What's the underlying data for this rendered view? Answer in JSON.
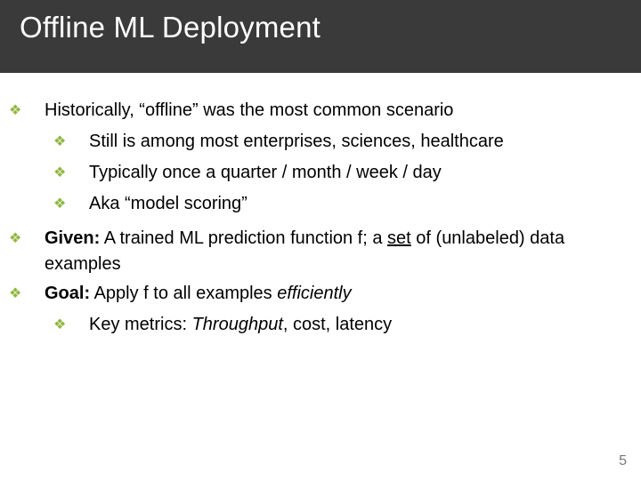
{
  "slide": {
    "title": "Offline ML Deployment",
    "page_number": "5",
    "bullets": {
      "b0": {
        "text": "Historically, “offline” was the most common scenario"
      },
      "b0_sub": {
        "s0": "Still is among most enterprises, sciences, healthcare",
        "s1": "Typically once a quarter / month / week / day",
        "s2": "Aka “model scoring”"
      },
      "b1": {
        "label": "Given:",
        "rest_a": " A trained ML prediction function f; a ",
        "underlined": "set",
        "rest_b": " of (unlabeled) data examples"
      },
      "b2": {
        "label": "Goal:",
        "rest_a": " Apply f to all examples ",
        "italic": "efficiently"
      },
      "b2_sub": {
        "s0_a": "Key metrics: ",
        "s0_italic": "Throughput",
        "s0_b": ", cost, latency"
      }
    }
  },
  "glyphs": {
    "diamond": "❖"
  }
}
